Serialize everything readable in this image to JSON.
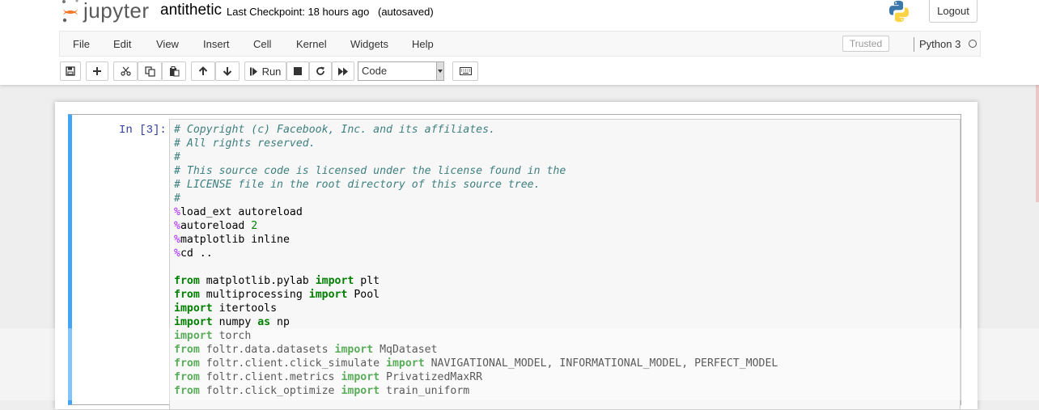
{
  "header": {
    "logo_text": "jupyter",
    "notebook_name": "antithetic",
    "checkpoint": "Last Checkpoint: 18 hours ago",
    "autosave": "(autosaved)",
    "logout_label": "Logout"
  },
  "menu": {
    "items": [
      "File",
      "Edit",
      "View",
      "Insert",
      "Cell",
      "Kernel",
      "Widgets",
      "Help"
    ],
    "trusted": "Trusted",
    "kernel": "Python 3"
  },
  "toolbar": {
    "run_label": "Run",
    "cell_type": "Code",
    "icons": [
      "save-icon",
      "plus-icon",
      "cut-icon",
      "copy-icon",
      "paste-icon",
      "arrow-up-icon",
      "arrow-down-icon",
      "step-forward-icon",
      "stop-icon",
      "restart-icon",
      "fast-forward-icon",
      "keyboard-icon"
    ]
  },
  "cell": {
    "prompt": "In [3]:",
    "lines": [
      [
        {
          "t": "# Copyright (c) Facebook, Inc. and its affiliates.",
          "c": "cm"
        }
      ],
      [
        {
          "t": "# All rights reserved.",
          "c": "cm"
        }
      ],
      [
        {
          "t": "#",
          "c": "cm"
        }
      ],
      [
        {
          "t": "# This source code is licensed under the license found in the",
          "c": "cm"
        }
      ],
      [
        {
          "t": "# LICENSE file in the root directory of this source tree.",
          "c": "cm"
        }
      ],
      [
        {
          "t": "#",
          "c": "cm"
        }
      ],
      [
        {
          "t": "%",
          "c": "mg"
        },
        {
          "t": "load_ext autoreload",
          "c": ""
        }
      ],
      [
        {
          "t": "%",
          "c": "mg"
        },
        {
          "t": "autoreload ",
          "c": ""
        },
        {
          "t": "2",
          "c": "nm"
        }
      ],
      [
        {
          "t": "%",
          "c": "mg"
        },
        {
          "t": "matplotlib inline",
          "c": ""
        }
      ],
      [
        {
          "t": "%",
          "c": "mg"
        },
        {
          "t": "cd ..",
          "c": ""
        }
      ],
      [
        {
          "t": "",
          "c": ""
        }
      ],
      [
        {
          "t": "from",
          "c": "kw"
        },
        {
          "t": " matplotlib.pylab ",
          "c": ""
        },
        {
          "t": "import",
          "c": "kw"
        },
        {
          "t": " plt",
          "c": ""
        }
      ],
      [
        {
          "t": "from",
          "c": "kw"
        },
        {
          "t": " multiprocessing ",
          "c": ""
        },
        {
          "t": "import",
          "c": "kw"
        },
        {
          "t": " Pool",
          "c": ""
        }
      ],
      [
        {
          "t": "import",
          "c": "kw"
        },
        {
          "t": " itertools",
          "c": ""
        }
      ],
      [
        {
          "t": "import",
          "c": "kw"
        },
        {
          "t": " numpy ",
          "c": ""
        },
        {
          "t": "as",
          "c": "kw"
        },
        {
          "t": " np",
          "c": ""
        }
      ],
      [
        {
          "t": "import",
          "c": "kw"
        },
        {
          "t": " torch",
          "c": ""
        }
      ],
      [
        {
          "t": "from",
          "c": "kw"
        },
        {
          "t": " foltr.data.datasets ",
          "c": ""
        },
        {
          "t": "import",
          "c": "kw"
        },
        {
          "t": " MqDataset",
          "c": ""
        }
      ],
      [
        {
          "t": "from",
          "c": "kw"
        },
        {
          "t": " foltr.client.click_simulate ",
          "c": ""
        },
        {
          "t": "import",
          "c": "kw"
        },
        {
          "t": " NAVIGATIONAL_MODEL, INFORMATIONAL_MODEL, PERFECT_MODEL",
          "c": ""
        }
      ],
      [
        {
          "t": "from",
          "c": "kw"
        },
        {
          "t": " foltr.client.metrics ",
          "c": ""
        },
        {
          "t": "import",
          "c": "kw"
        },
        {
          "t": " PrivatizedMaxRR",
          "c": ""
        }
      ],
      [
        {
          "t": "from",
          "c": "kw"
        },
        {
          "t": " foltr.click_optimize ",
          "c": ""
        },
        {
          "t": "import",
          "c": "kw"
        },
        {
          "t": " train_uniform",
          "c": ""
        }
      ]
    ]
  },
  "colors": {
    "accent": "#42a5f5",
    "prompt": "#303f9f",
    "comment": "#408080",
    "keyword": "#008000",
    "magic": "#aa22ff"
  }
}
